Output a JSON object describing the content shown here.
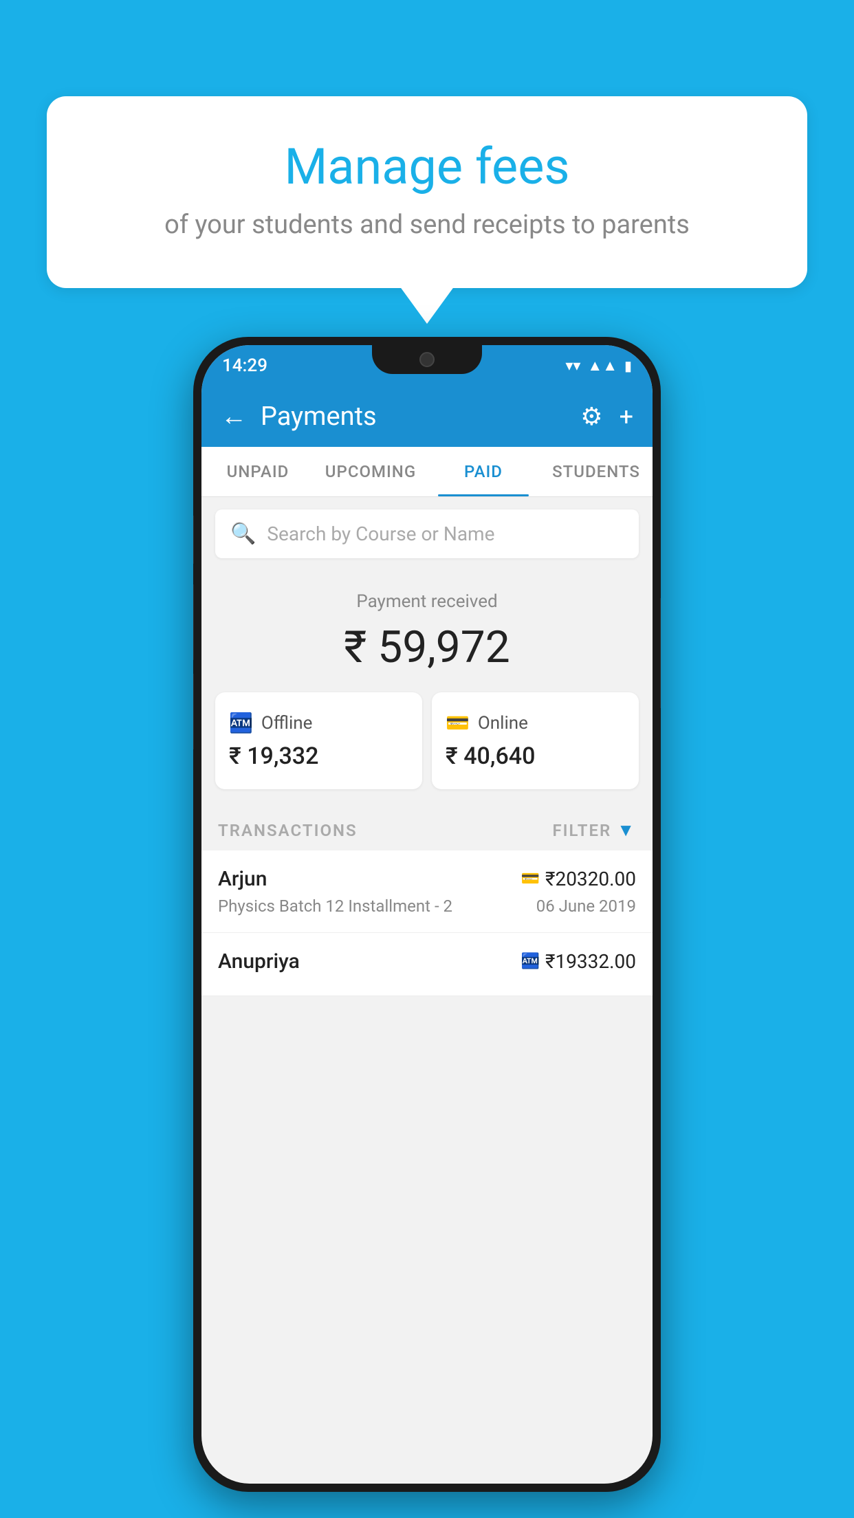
{
  "background_color": "#1ab0e8",
  "speech_bubble": {
    "title": "Manage fees",
    "subtitle": "of your students and send receipts to parents"
  },
  "status_bar": {
    "time": "14:29",
    "wifi": "▾",
    "signal": "▲",
    "battery": "▮"
  },
  "app_bar": {
    "title": "Payments",
    "back_label": "←",
    "gear_label": "⚙",
    "plus_label": "+"
  },
  "tabs": [
    {
      "label": "UNPAID",
      "active": false
    },
    {
      "label": "UPCOMING",
      "active": false
    },
    {
      "label": "PAID",
      "active": true
    },
    {
      "label": "STUDENTS",
      "active": false
    }
  ],
  "search": {
    "placeholder": "Search by Course or Name"
  },
  "payment_summary": {
    "label": "Payment received",
    "total": "₹ 59,972",
    "offline_label": "Offline",
    "offline_amount": "₹ 19,332",
    "online_label": "Online",
    "online_amount": "₹ 40,640"
  },
  "transactions": {
    "section_label": "TRANSACTIONS",
    "filter_label": "FILTER",
    "items": [
      {
        "name": "Arjun",
        "course": "Physics Batch 12 Installment - 2",
        "amount": "₹20320.00",
        "date": "06 June 2019",
        "payment_type": "card"
      },
      {
        "name": "Anupriya",
        "course": "",
        "amount": "₹19332.00",
        "date": "",
        "payment_type": "cash"
      }
    ]
  }
}
